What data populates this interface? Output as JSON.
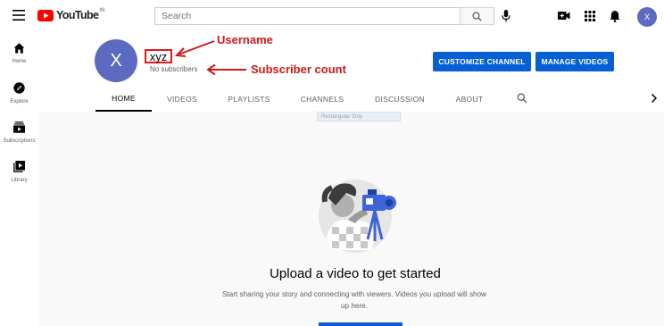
{
  "app": {
    "logo_text": "YouTube",
    "country_code": "IN"
  },
  "search": {
    "placeholder": "Search"
  },
  "account": {
    "avatar_letter": "X"
  },
  "sidebar": {
    "items": [
      {
        "label": "Home",
        "icon": "home-icon"
      },
      {
        "label": "Explore",
        "icon": "compass-icon"
      },
      {
        "label": "Subscriptions",
        "icon": "subscriptions-icon"
      },
      {
        "label": "Library",
        "icon": "library-icon"
      }
    ]
  },
  "channel": {
    "avatar_letter": "X",
    "name": "xyz",
    "subscribers": "No subscribers",
    "customize_label": "CUSTOMIZE CHANNEL",
    "manage_label": "MANAGE VIDEOS"
  },
  "tabs": [
    {
      "label": "HOME",
      "active": true
    },
    {
      "label": "VIDEOS",
      "active": false
    },
    {
      "label": "PLAYLISTS",
      "active": false
    },
    {
      "label": "CHANNELS",
      "active": false
    },
    {
      "label": "DISCUSSION",
      "active": false
    },
    {
      "label": "ABOUT",
      "active": false
    }
  ],
  "annotations": {
    "username": "Username",
    "subscriber_count": "Subscriber count"
  },
  "overlay": {
    "snip_label": "Rectangular Snip"
  },
  "empty_state": {
    "title": "Upload a video to get started",
    "description": "Start sharing your story and connecting with viewers. Videos you upload will show up here."
  },
  "colors": {
    "brand_red": "#ff0000",
    "accent_blue": "#065fd4",
    "avatar_purple": "#5c6bc0",
    "annotation_red": "#d01818"
  }
}
